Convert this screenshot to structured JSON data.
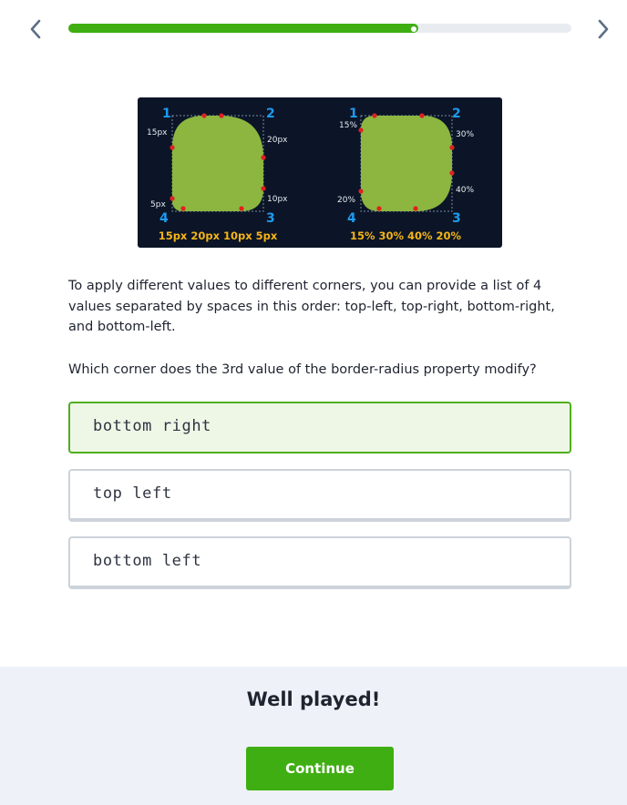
{
  "header": {
    "back_icon": "chevron-left-icon",
    "forward_icon": "chevron-right-icon",
    "progress": 0.695,
    "progress_color": "#3fae12"
  },
  "illustration": {
    "left_box": {
      "corner_numbers": [
        "1",
        "2",
        "3",
        "4"
      ],
      "labels": [
        "15px",
        "20px",
        "10px",
        "5px"
      ],
      "caption": "15px 20px 10px 5px"
    },
    "right_box": {
      "corner_numbers": [
        "1",
        "2",
        "3",
        "4"
      ],
      "labels": [
        "15%",
        "30%",
        "40%",
        "20%"
      ],
      "caption": "15% 30% 40% 20%"
    },
    "colors": {
      "background": "#0b1527",
      "shape": "#8cb63f",
      "corner_numbers": "#1e9bf0",
      "caption": "#f5b417",
      "marker": "#e02020"
    }
  },
  "content": {
    "paragraph": "To apply different values to different corners, you can provide a list of 4 values separated by spaces in this order: top-left, top-right, bottom-right, and bottom-left.",
    "question": "Which corner does the 3rd value of the border-radius property modify?"
  },
  "options": [
    {
      "label": "bottom right",
      "selected": true
    },
    {
      "label": "top left",
      "selected": false
    },
    {
      "label": "bottom left",
      "selected": false
    }
  ],
  "footer": {
    "title": "Well played!",
    "continue_label": "Continue",
    "button_color": "#3fae12"
  }
}
